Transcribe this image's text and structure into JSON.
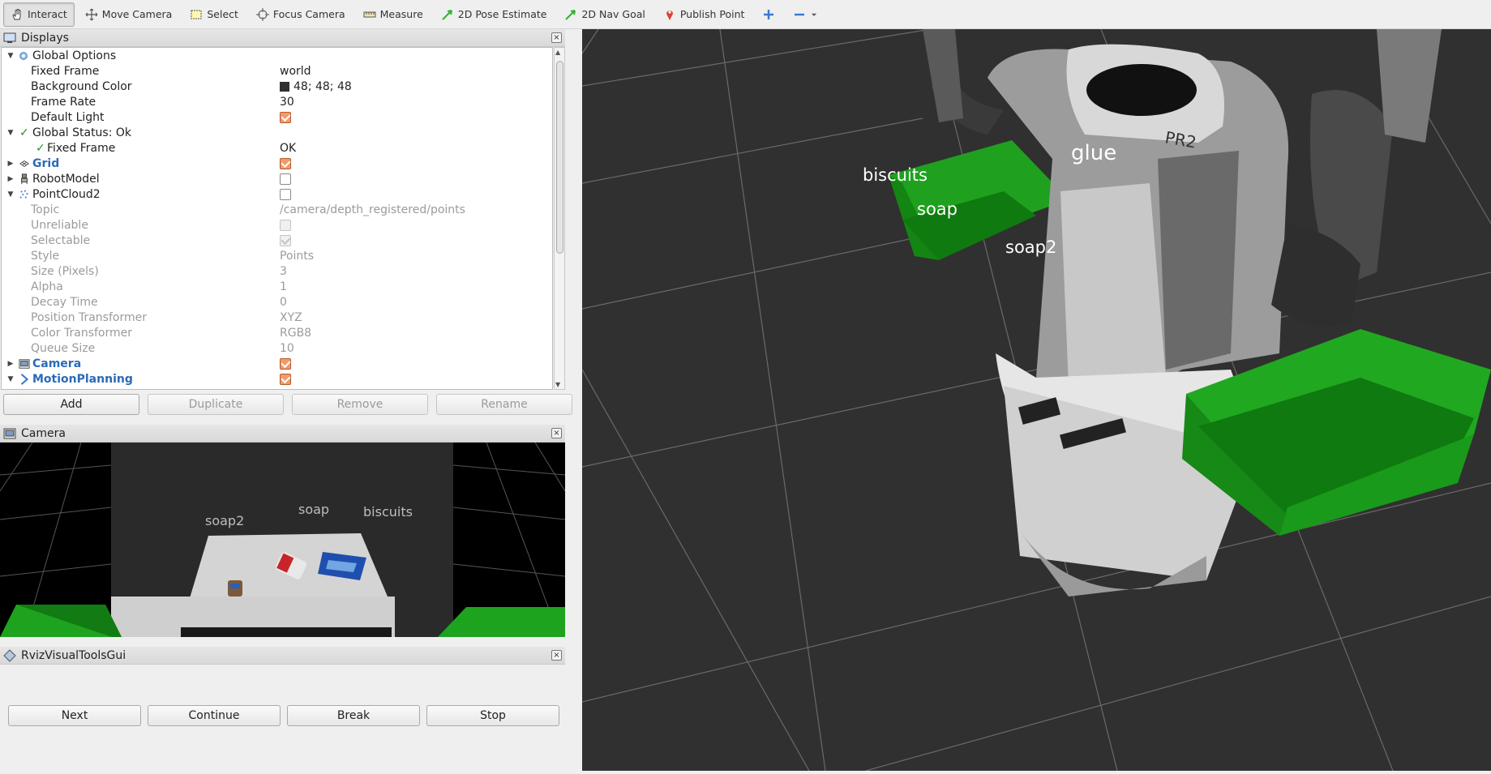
{
  "toolbar": {
    "tools": [
      {
        "label": "Interact",
        "icon": "hand-icon"
      },
      {
        "label": "Move Camera",
        "icon": "move-icon"
      },
      {
        "label": "Select",
        "icon": "select-box-icon"
      },
      {
        "label": "Focus Camera",
        "icon": "focus-icon"
      },
      {
        "label": "Measure",
        "icon": "ruler-icon"
      },
      {
        "label": "2D Pose Estimate",
        "icon": "pose-arrow-icon"
      },
      {
        "label": "2D Nav Goal",
        "icon": "nav-arrow-icon"
      },
      {
        "label": "Publish Point",
        "icon": "pin-icon"
      }
    ]
  },
  "displays": {
    "title": "Displays",
    "rows": [
      {
        "name": "Global Options",
        "value": ""
      },
      {
        "name": "Fixed Frame",
        "value": "world"
      },
      {
        "name": "Background Color",
        "value": "48; 48; 48"
      },
      {
        "name": "Frame Rate",
        "value": "30"
      },
      {
        "name": "Default Light",
        "value": ""
      },
      {
        "name": "Global Status: Ok",
        "value": ""
      },
      {
        "name": "Fixed Frame",
        "value": "OK"
      },
      {
        "name": "Grid",
        "value": ""
      },
      {
        "name": "RobotModel",
        "value": ""
      },
      {
        "name": "PointCloud2",
        "value": ""
      },
      {
        "name": "Topic",
        "value": "/camera/depth_registered/points"
      },
      {
        "name": "Unreliable",
        "value": ""
      },
      {
        "name": "Selectable",
        "value": ""
      },
      {
        "name": "Style",
        "value": "Points"
      },
      {
        "name": "Size (Pixels)",
        "value": "3"
      },
      {
        "name": "Alpha",
        "value": "1"
      },
      {
        "name": "Decay Time",
        "value": "0"
      },
      {
        "name": "Position Transformer",
        "value": "XYZ"
      },
      {
        "name": "Color Transformer",
        "value": "RGB8"
      },
      {
        "name": "Queue Size",
        "value": "10"
      },
      {
        "name": "Camera",
        "value": ""
      },
      {
        "name": "MotionPlanning",
        "value": ""
      }
    ],
    "buttons": {
      "add": "Add",
      "duplicate": "Duplicate",
      "remove": "Remove",
      "rename": "Rename"
    }
  },
  "camera": {
    "title": "Camera",
    "labels": {
      "soap2": "soap2",
      "soap": "soap",
      "biscuits": "biscuits"
    }
  },
  "rvizgui": {
    "title": "RvizVisualToolsGui",
    "buttons": {
      "next": "Next",
      "continue": "Continue",
      "break": "Break",
      "stop": "Stop"
    }
  },
  "viewport": {
    "background": "#303030",
    "labels": {
      "biscuits": "biscuits",
      "soap": "soap",
      "soap2": "soap2",
      "glue": "glue",
      "robot": "PR2"
    }
  }
}
